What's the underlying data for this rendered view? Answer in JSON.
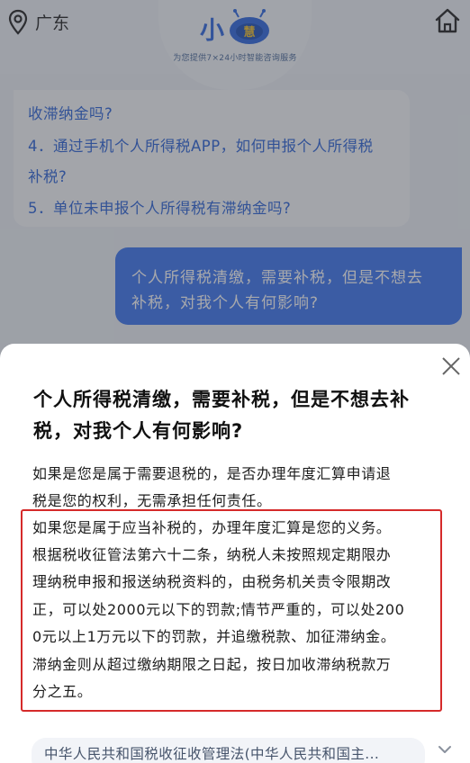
{
  "header": {
    "location": "广东",
    "logo_text": "小",
    "logo_badge": "慧",
    "slogan": "为您提供7×24小时智能咨询服务"
  },
  "faq": {
    "lines": [
      "收滞纳金吗?",
      "4．通过手机个人所得税APP，如何申报个人所得税",
      "补税?",
      "5．单位未申报个人所得税有滞纳金吗?"
    ]
  },
  "user_message": {
    "lines": [
      "个人所得税清缴，需要补税，但是不想去",
      "补税，对我个人有何影响?"
    ]
  },
  "answer": {
    "title_lines": [
      "个人所得税清缴，需要补税，但是不想去补",
      "税，对我个人有何影响?"
    ],
    "intro_lines": [
      "如果是您是属于需要退税的，是否办理年度汇算申请退",
      "税是您的权利，无需承担任何责任。"
    ],
    "highlighted_lines": [
      "如果您是属于应当补税的，办理年度汇算是您的义务。",
      "根据税收征管法第六十二条，纳税人未按照规定期限办",
      "理纳税申报和报送纳税资料的，由税务机关责令限期改",
      "正，可以处2000元以下的罚款;情节严重的，可以处200",
      "0元以上1万元以下的罚款，并追缴税款、加征滞纳金。",
      "滞纳金则从超过缴纳期限之日起，按日加收滞纳税款万",
      "分之五。"
    ],
    "reference": "中华人民共和国税收征收管理法(中华人民共和国主..."
  },
  "colors": {
    "link_blue": "#2b63d8",
    "user_bubble": "#3b76f1",
    "highlight_border": "#d52a2a"
  },
  "icons": {
    "location": "location-pin-icon",
    "home": "home-icon",
    "close": "close-icon",
    "expand": "chevron-down-icon"
  }
}
